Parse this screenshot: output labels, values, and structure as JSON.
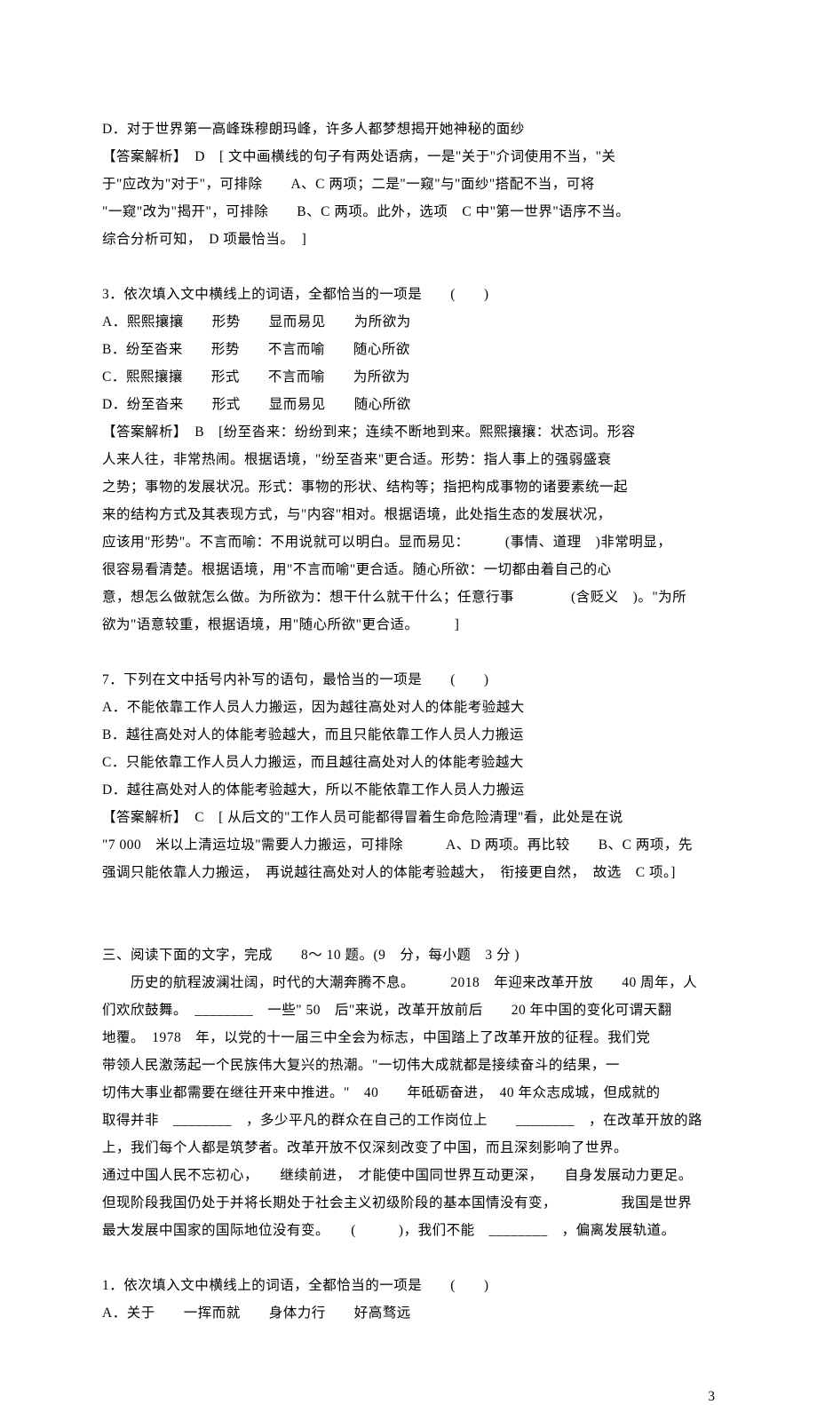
{
  "lines": {
    "l1": "D．对于世界第一高峰珠穆朗玛峰，许多人都梦想揭开她神秘的面纱",
    "l2": "【答案解析】　D　[ 文中画横线的句子有两处语病，一是\"关于\"介词使用不当，\"关",
    "l3": "于\"应改为\"对于\"，可排除　　A、C 两项；二是\"一窥\"与\"面纱\"搭配不当，可将",
    "l4": "\"一窥\"改为\"揭开\"，可排除　　B、C 两项。此外，选项　C 中\"第一世界\"语序不当。",
    "l5": "综合分析可知，　D 项最恰当。　]",
    "l6": "3．依次填入文中横线上的词语，全都恰当的一项是　　(　　)",
    "l7": "A．熙熙攘攘　　形势　　显而易见　　为所欲为",
    "l8": "B．纷至沓来　　形势　　不言而喻　　随心所欲",
    "l9": "C．熙熙攘攘　　形式　　不言而喻　　为所欲为",
    "l10": "D．纷至沓来　　形式　　显而易见　　随心所欲",
    "l11": "【答案解析】　B　[纷至沓来：纷纷到来；连续不断地到来。熙熙攘攘：状态词。形容",
    "l12": "人来人往，非常热闹。根据语境，\"纷至沓来\"更合适。形势：指人事上的强弱盛衰",
    "l13": "之势；事物的发展状况。形式：事物的形状、结构等；指把构成事物的诸要素统一起",
    "l14": "来的结构方式及其表现方式，与\"内容\"相对。根据语境，此处指生态的发展状况，",
    "l15": "应该用\"形势\"。不言而喻：不用说就可以明白。显而易见：　　　(事情、道理　)非常明显，",
    "l16": "很容易看清楚。根据语境，用\"不言而喻\"更合适。随心所欲：一切都由着自己的心",
    "l17": "意，想怎么做就怎么做。为所欲为：想干什么就干什么；任意行事　　　　(含贬义　)。\"为所",
    "l18": "欲为\"语意较重，根据语境，用\"随心所欲\"更合适。　　　]",
    "l19": "7．下列在文中括号内补写的语句，最恰当的一项是　　(　　)",
    "l20": "A．不能依靠工作人员人力搬运，因为越往高处对人的体能考验越大",
    "l21": "B．越往高处对人的体能考验越大，而且只能依靠工作人员人力搬运",
    "l22": "C．只能依靠工作人员人力搬运，而且越往高处对人的体能考验越大",
    "l23": "D．越往高处对人的体能考验越大，所以不能依靠工作人员人力搬运",
    "l24": "【答案解析】　C　[ 从后文的\"工作人员可能都得冒着生命危险清理\"看，此处是在说",
    "l25": "\"7 000　米以上清运垃圾\"需要人力搬运，可排除　　　A、D 两项。再比较　　B、C 两项，先",
    "l26": "强调只能依靠人力搬运，　再说越往高处对人的体能考验越大，　衔接更自然，　故选　C 项。]",
    "l27": "三、阅读下面的文字，完成　　8～ 10 题。(9　分，每小题　3 分 )",
    "l28": "历史的航程波澜壮阔，时代的大潮奔腾不息。　　　2018　年迎来改革开放　　40 周年，人",
    "l29": "们欢欣鼓舞。　________　一些\" 50　后\"来说，改革开放前后　　20 年中国的变化可谓天翻",
    "l30": "地覆。　1978　年，以党的十一届三中全会为标志，中国踏上了改革开放的征程。我们党",
    "l31": "带领人民激荡起一个民族伟大复兴的热潮。\"一切伟大成就都是接续奋斗的结果，一",
    "l32": "切伟大事业都需要在继往开来中推进。\"　40　　年砥砺奋进，　40 年众志成城，但成就的",
    "l33": "取得并非　________　，多少平凡的群众在自己的工作岗位上　　________　，在改革开放的路",
    "l34": "上，我们每个人都是筑梦者。改革开放不仅深刻改变了中国，而且深刻影响了世界。",
    "l35": "通过中国人民不忘初心，　　继续前进，　才能使中国同世界互动更深，　　自身发展动力更足。",
    "l36": "但现阶段我国仍处于并将长期处于社会主义初级阶段的基本国情没有变，　　　　　我国是世界",
    "l37": "最大发展中国家的国际地位没有变。　　(　　　)，我们不能　________　，偏离发展轨道。",
    "l38": "1．依次填入文中横线上的词语，全都恰当的一项是　　(　　)",
    "l39": "A．关于　　一挥而就　　身体力行　　好高骛远"
  },
  "pageNumber": "3"
}
